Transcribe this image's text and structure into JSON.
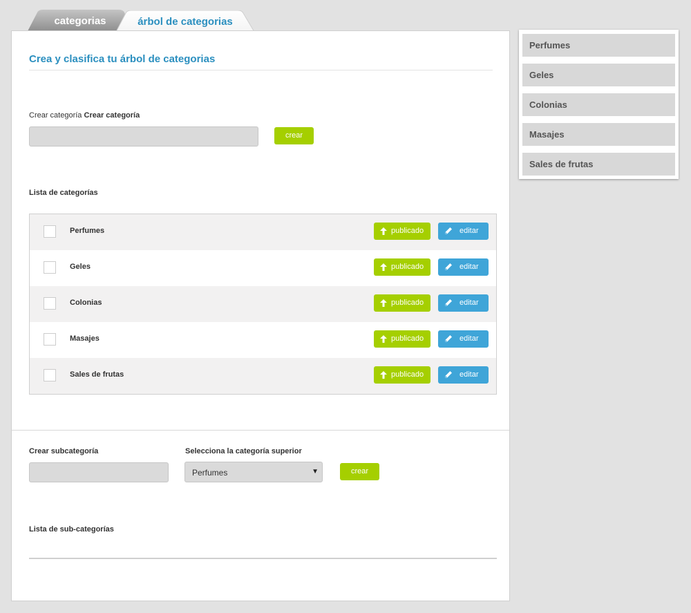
{
  "tabs": [
    {
      "label": "categorias",
      "active": false
    },
    {
      "label": "árbol de categorias",
      "active": true
    }
  ],
  "main": {
    "heading": "Crea y clasifica tu árbol de categorias",
    "create": {
      "label_prefix": "Crear categoría",
      "label_bold": "Crear categoría",
      "input_value": "",
      "button_label": "crear"
    },
    "list_title": "Lista de categorías",
    "categories": [
      {
        "name": "Perfumes",
        "status_label": "publicado",
        "edit_label": "editar"
      },
      {
        "name": "Geles",
        "status_label": "publicado",
        "edit_label": "editar"
      },
      {
        "name": "Colonias",
        "status_label": "publicado",
        "edit_label": "editar"
      },
      {
        "name": "Masajes",
        "status_label": "publicado",
        "edit_label": "editar"
      },
      {
        "name": "Sales de frutas",
        "status_label": "publicado",
        "edit_label": "editar"
      }
    ],
    "subcategory": {
      "label": "Crear subcategoría",
      "input_value": "",
      "parent_label": "Selecciona la categoría superior",
      "parent_selected": "Perfumes",
      "button_label": "crear"
    },
    "sub_list_title": "Lista de sub-categorías"
  },
  "sidebar": {
    "items": [
      "Perfumes",
      "Geles",
      "Colonias",
      "Masajes",
      "Sales de frutas"
    ]
  },
  "colors": {
    "accent_blue": "#2b8fbf",
    "green": "#a5cf00",
    "edit_blue": "#3fa5d8",
    "background": "#e2e2e2"
  },
  "icons": {
    "publish": "arrow-up-icon",
    "edit": "pencil-icon",
    "select": "caret-down-icon"
  }
}
